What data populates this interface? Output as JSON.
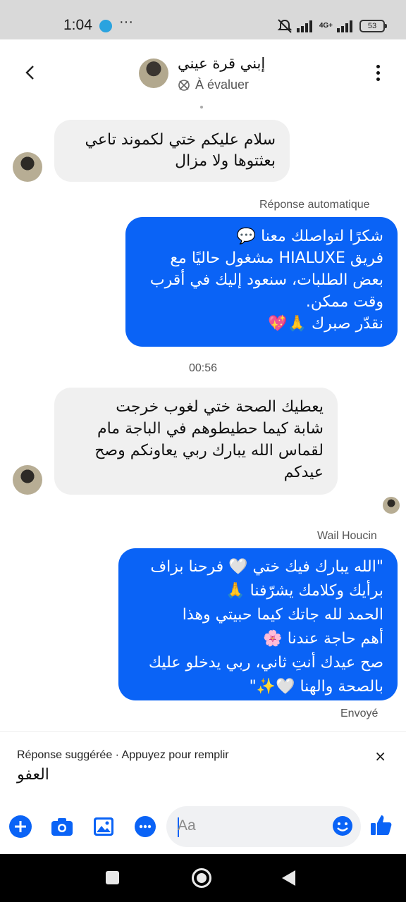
{
  "status_bar": {
    "time": "1:04",
    "more": "···",
    "network": "4G+",
    "battery": "53"
  },
  "header": {
    "contact_name": "إبني قرة عيني",
    "status_text": "À évaluer"
  },
  "messages": {
    "m1": "سلام عليكم ختي لكموند تاعي\nبعثتوها ولا مزال",
    "auto_label": "Réponse automatique",
    "m2": "شكرًا لتواصلك معنا 💬\nفريق HIALUXE مشغول حاليًا مع\nبعض الطلبات، سنعود إليك في أقرب\nوقت ممكن.\nنقدّر صبرك 🙏💖",
    "timestamp": "00:56",
    "m3": "يعطيك الصحة ختي لغوب خرجت\nشابة كيما حطيطوهم في الباجة مام\nلقماس  الله يبارك ربي يعاونكم  وصح\nعيدكم",
    "sender_label": "Wail Houcin",
    "m4": "\"الله يبارك فيك ختي 🤍 فرحنا بزاف\nبرأيك وكلامك يشرّفنا 🙏\nالحمد لله جاتك كيما حبيتي وهذا\nأهم حاجة عندنا 🌸\nصح عيدك أنتِ ثاني، ربي يدخلو عليك\nبالصحة والهنا 🤍✨\"",
    "sent_label": "Envoyé"
  },
  "suggestion": {
    "title": "Réponse suggérée · Appuyez pour remplir",
    "reply": "العفو",
    "close": "×"
  },
  "composer": {
    "placeholder": "Aa"
  },
  "colors": {
    "accent": "#0a63f6",
    "incoming_bubble": "#f0f0f0",
    "status_bar": "#d9d9d9"
  },
  "icons": [
    "back-icon",
    "more-vertical-icon",
    "plus-icon",
    "camera-icon",
    "gallery-icon",
    "mic-icon",
    "emoji-icon",
    "like-icon"
  ]
}
